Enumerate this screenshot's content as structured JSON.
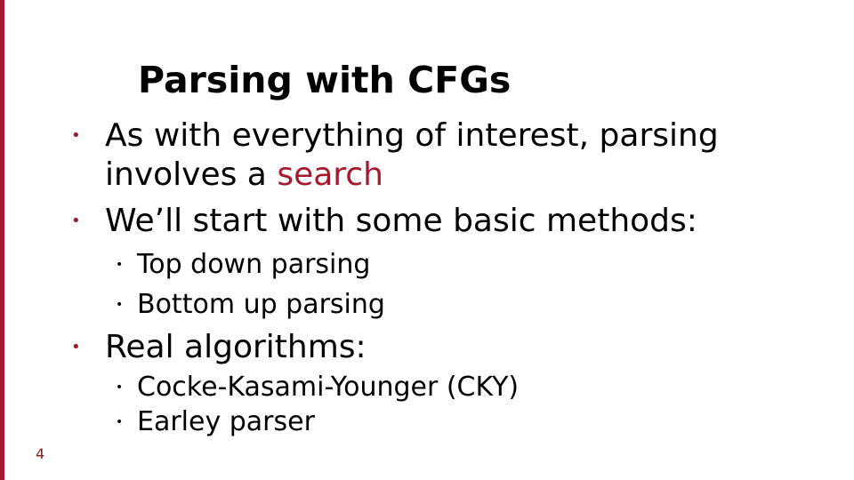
{
  "slide": {
    "title": "Parsing with CFGs",
    "bullets": [
      {
        "line1": "As with everything of interest, parsing",
        "line2_prefix": "involves a ",
        "line2_highlight": "search"
      },
      {
        "text": "We’ll start with some basic methods:",
        "sub": [
          "Top down parsing",
          "Bottom up parsing"
        ]
      },
      {
        "text": "Real algorithms:",
        "sub": [
          "Cocke-Kasami-Younger (CKY)",
          "Earley parser"
        ]
      }
    ],
    "bullet_glyph": "•",
    "page_number": "4"
  },
  "colors": {
    "accent": "#a6192e",
    "text": "#000000",
    "background": "#ffffff"
  }
}
